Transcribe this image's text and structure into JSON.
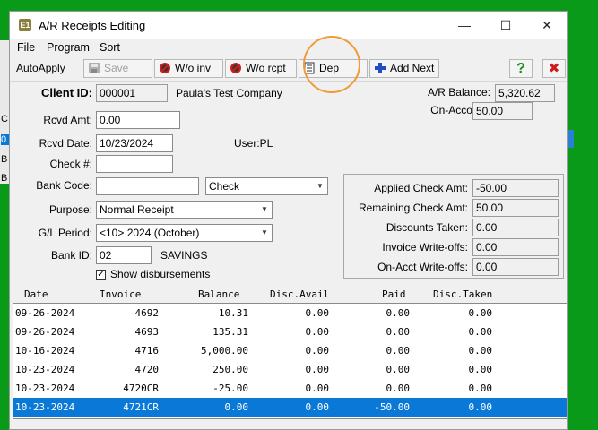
{
  "window": {
    "title": "A/R Receipts Editing",
    "app_icon": "E1",
    "controls": {
      "minimize": "—",
      "maximize": "☐",
      "close": "✕"
    }
  },
  "menu": [
    "File",
    "Program",
    "Sort"
  ],
  "toolbar": {
    "autoapply": "AutoApply",
    "save": "Save",
    "wo_inv": "W/o inv",
    "wo_rcpt": "W/o rcpt",
    "dep": "Dep",
    "add_next": "Add Next",
    "help": "?",
    "exit": "✖"
  },
  "client": {
    "label": "Client ID:",
    "id": "000001",
    "name": "Paula's Test Company"
  },
  "balances": {
    "ar_label": "A/R Balance:",
    "ar_value": "5,320.62",
    "onaccount_label": "On-Account:",
    "onaccount_value": "50.00"
  },
  "form": {
    "rcvd_amt_label": "Rcvd Amt:",
    "rcvd_amt": "0.00",
    "rcvd_date_label": "Rcvd Date:",
    "rcvd_date": "10/23/2024",
    "user": "User:PL",
    "check_label": "Check #:",
    "check": "",
    "bank_code_label": "Bank Code:",
    "bank_code": "",
    "bank_type": "Check",
    "purpose_label": "Purpose:",
    "purpose": "Normal Receipt",
    "gl_label": "G/L Period:",
    "gl_period": "<10> 2024 (October)",
    "bank_id_label": "Bank ID:",
    "bank_id": "02",
    "bank_name": "SAVINGS",
    "show_disb": "Show disbursements"
  },
  "summary": {
    "applied_label": "Applied Check Amt:",
    "applied": "-50.00",
    "remaining_label": "Remaining Check Amt:",
    "remaining": "50.00",
    "discounts_label": "Discounts Taken:",
    "discounts": "0.00",
    "inv_wo_label": "Invoice Write-offs:",
    "inv_wo": "0.00",
    "acct_wo_label": "On-Acct Write-offs:",
    "acct_wo": "0.00"
  },
  "grid": {
    "headers": [
      "Date",
      "Invoice",
      "Balance",
      "Disc.Avail",
      "Paid",
      "Disc.Taken"
    ],
    "rows": [
      [
        "09-26-2024",
        "4692",
        "10.31",
        "0.00",
        "0.00",
        "0.00"
      ],
      [
        "09-26-2024",
        "4693",
        "135.31",
        "0.00",
        "0.00",
        "0.00"
      ],
      [
        "10-16-2024",
        "4716",
        "5,000.00",
        "0.00",
        "0.00",
        "0.00"
      ],
      [
        "10-23-2024",
        "4720",
        "250.00",
        "0.00",
        "0.00",
        "0.00"
      ],
      [
        "10-23-2024",
        "4720CR",
        "-25.00",
        "0.00",
        "0.00",
        "0.00"
      ],
      [
        "10-23-2024",
        "4721CR",
        "0.00",
        "0.00",
        "-50.00",
        "0.00"
      ]
    ]
  },
  "background_left": [
    "C:",
    "0",
    "B",
    "B"
  ],
  "colors": {
    "selection": "#0a78d7",
    "highlight_circle": "#f09a3a",
    "desktop": "#0a9a1a"
  }
}
